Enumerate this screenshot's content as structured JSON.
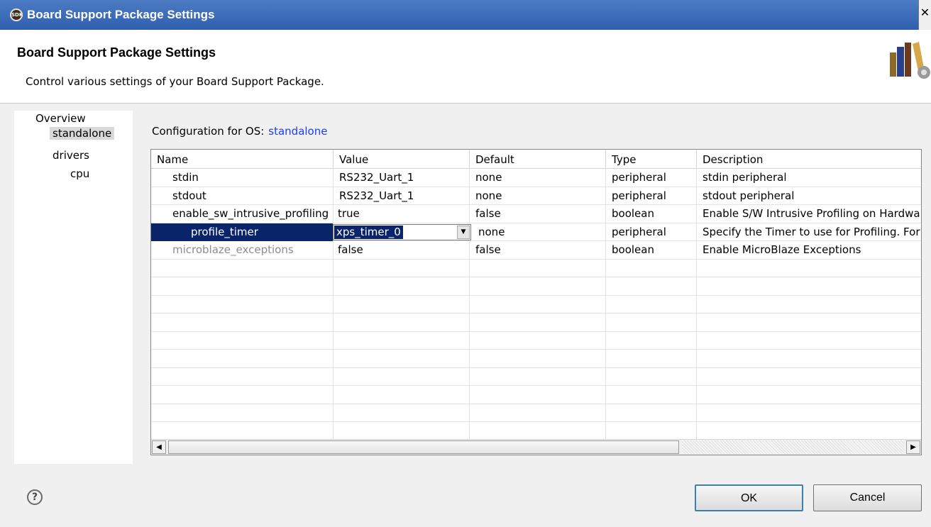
{
  "window": {
    "title": "Board Support Package Settings",
    "app_icon_text": "SDK",
    "close": "✕"
  },
  "header": {
    "title": "Board Support Package Settings",
    "description": "Control various settings of your Board Support Package."
  },
  "nav": {
    "items": [
      {
        "label": "Overview",
        "level": 0,
        "selected": false
      },
      {
        "label": "standalone",
        "level": 1,
        "selected": true
      },
      {
        "label": "drivers",
        "level": 1,
        "selected": false
      },
      {
        "label": "cpu",
        "level": 2,
        "selected": false
      }
    ]
  },
  "config": {
    "label": "Configuration for OS:",
    "os": "standalone"
  },
  "table": {
    "columns": [
      "Name",
      "Value",
      "Default",
      "Type",
      "Description"
    ],
    "rows": [
      {
        "name": "stdin",
        "value": "RS232_Uart_1",
        "default": "none",
        "type": "peripheral",
        "description": "stdin peripheral"
      },
      {
        "name": "stdout",
        "value": "RS232_Uart_1",
        "default": "none",
        "type": "peripheral",
        "description": "stdout peripheral"
      },
      {
        "name": "enable_sw_intrusive_profiling",
        "value": "true",
        "default": "false",
        "type": "boolean",
        "description": "Enable S/W Intrusive Profiling on Hardwa"
      },
      {
        "name": "profile_timer",
        "value": "xps_timer_0",
        "default": "none",
        "type": "peripheral",
        "description": "Specify the Timer to use for Profiling. For"
      },
      {
        "name": "microblaze_exceptions",
        "value": "false",
        "default": "false",
        "type": "boolean",
        "description": "Enable MicroBlaze Exceptions"
      }
    ]
  },
  "scroll": {
    "left": "◀",
    "right": "▶"
  },
  "buttons": {
    "ok": "OK",
    "cancel": "Cancel",
    "help": "?"
  },
  "colors": {
    "selection": "#0a246a",
    "link": "#1a3cff",
    "titlebar": "#3a6ab8"
  }
}
